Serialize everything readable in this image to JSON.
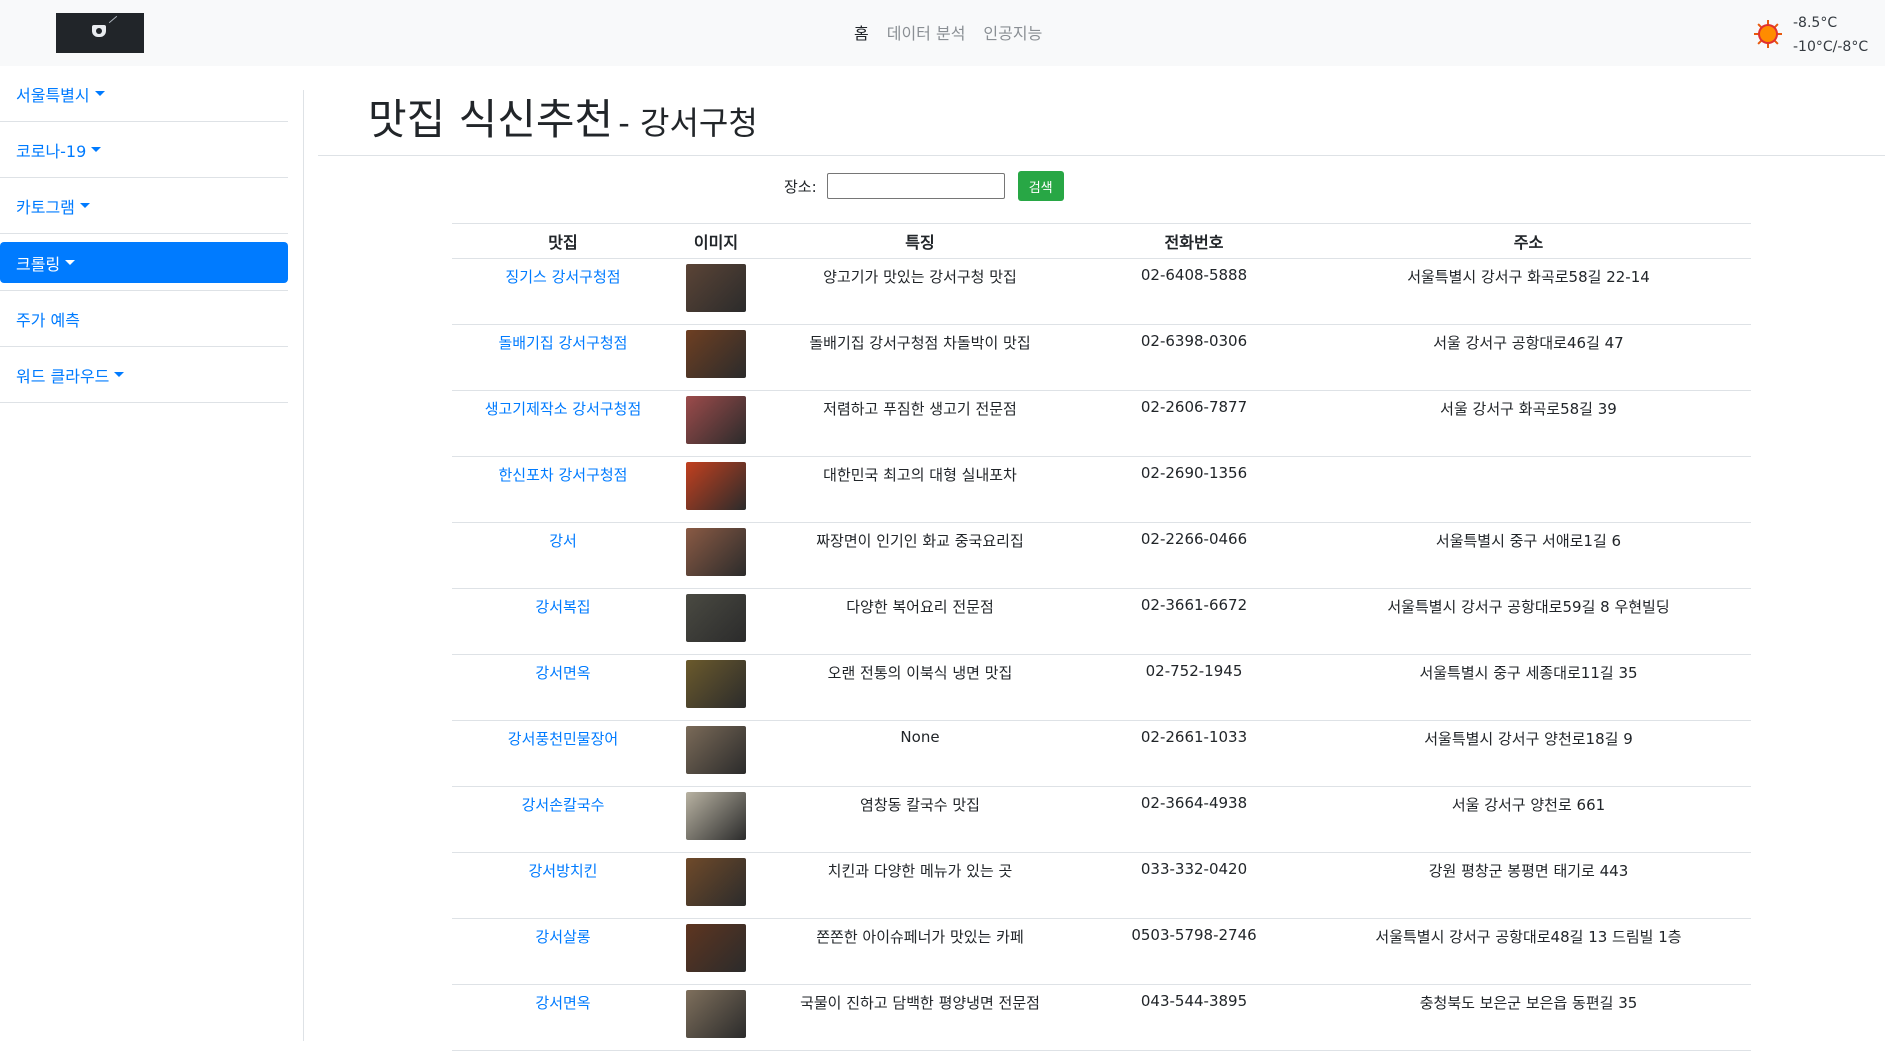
{
  "nav": {
    "items": [
      {
        "label": "홈",
        "active": true
      },
      {
        "label": "데이터 분석",
        "active": false
      },
      {
        "label": "인공지능",
        "active": false
      }
    ],
    "weather": {
      "icon": "sun-icon",
      "current": "-8.5°C",
      "range": "-10°C/-8°C"
    }
  },
  "sidebar": {
    "items": [
      {
        "label": "서울특별시",
        "dropdown": true,
        "active": false
      },
      {
        "label": "코로나-19",
        "dropdown": true,
        "active": false
      },
      {
        "label": "카토그램",
        "dropdown": true,
        "active": false
      },
      {
        "label": "크롤링",
        "dropdown": true,
        "active": true
      },
      {
        "label": "주가 예측",
        "dropdown": false,
        "active": false
      },
      {
        "label": "워드 클라우드",
        "dropdown": true,
        "active": false
      }
    ]
  },
  "page": {
    "title": "맛집 식신추천",
    "subtitle": "- 강서구청"
  },
  "search": {
    "label": "장소:",
    "value": "",
    "button": "검색"
  },
  "table": {
    "headers": [
      "맛집",
      "이미지",
      "특징",
      "전화번호",
      "주소"
    ],
    "rows": [
      {
        "name": "징기스 강서구청점",
        "feature": "양고기가 맛있는 강서구청 맛집",
        "phone": "02-6408-5888",
        "address": "서울특별시 강서구 화곡로58길 22-14",
        "img": "#5b4436"
      },
      {
        "name": "돌배기집 강서구청점",
        "feature": "돌배기집 강서구청점 차돌박이 맛집",
        "phone": "02-6398-0306",
        "address": "서울 강서구 공항대로46길 47",
        "img": "#6e3f22"
      },
      {
        "name": "생고기제작소 강서구청점",
        "feature": "저렴하고 푸짐한 생고기 전문점",
        "phone": "02-2606-7877",
        "address": "서울 강서구 화곡로58길 39",
        "img": "#9c4b4b"
      },
      {
        "name": "한신포차 강서구청점",
        "feature": "대한민국 최고의 대형 실내포차",
        "phone": "02-2690-1356",
        "address": "",
        "img": "#c2401f"
      },
      {
        "name": "강서",
        "feature": "짜장면이 인기인 화교 중국요리집",
        "phone": "02-2266-0466",
        "address": "서울특별시 중구 서애로1길 6",
        "img": "#8a5a44"
      },
      {
        "name": "강서복집",
        "feature": "다양한 복어요리 전문점",
        "phone": "02-3661-6672",
        "address": "서울특별시 강서구 공항대로59길 8 우현빌딩",
        "img": "#4a4a42"
      },
      {
        "name": "강서면옥",
        "feature": "오랜 전통의 이북식 냉면 맛집",
        "phone": "02-752-1945",
        "address": "서울특별시 중구 세종대로11길 35",
        "img": "#6b5a2c"
      },
      {
        "name": "강서풍천민물장어",
        "feature": "None",
        "phone": "02-2661-1033",
        "address": "서울특별시 강서구 양천로18길 9",
        "img": "#7a6a58"
      },
      {
        "name": "강서손칼국수",
        "feature": "염창동 칼국수 맛집",
        "phone": "02-3664-4938",
        "address": "서울 강서구 양천로 661",
        "img": "#b8b2a2"
      },
      {
        "name": "강서방치킨",
        "feature": "치킨과 다양한 메뉴가 있는 곳",
        "phone": "033-332-0420",
        "address": "강원 평창군 봉평면 태기로 443",
        "img": "#6f4a2a"
      },
      {
        "name": "강서살롱",
        "feature": "쫀쫀한 아이슈페너가 맛있는 카페",
        "phone": "0503-5798-2746",
        "address": "서울특별시 강서구 공항대로48길 13 드림빌 1층",
        "img": "#5e3520"
      },
      {
        "name": "강서면옥",
        "feature": "국물이 진하고 담백한 평양냉면 전문점",
        "phone": "043-544-3895",
        "address": "충청북도 보은군 보은읍 동편길 35",
        "img": "#7e6f5c"
      }
    ]
  },
  "colors": {
    "link": "#007bff",
    "active_bg": "#007bff",
    "button_green": "#28a745",
    "navbar_bg": "#f8f9fa"
  }
}
